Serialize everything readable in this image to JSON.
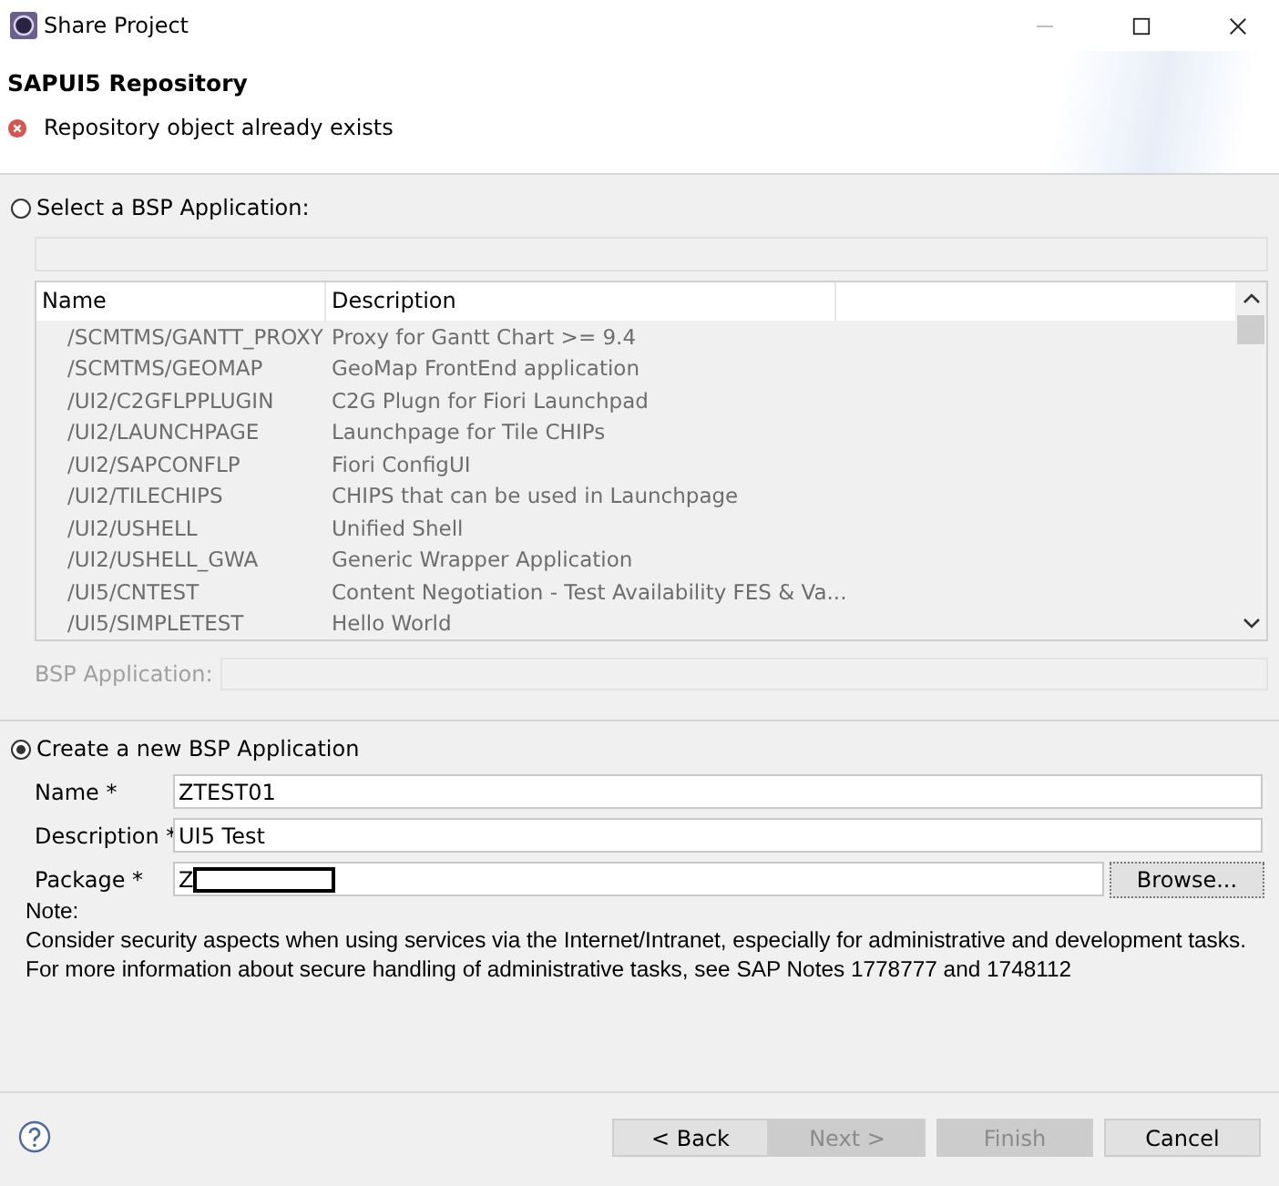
{
  "window": {
    "title": "Share Project"
  },
  "header": {
    "title": "SAPUI5 Repository",
    "message": {
      "kind": "error",
      "text": "Repository object already exists"
    }
  },
  "select_option": {
    "label": "Select a BSP Application:",
    "selected": false
  },
  "table": {
    "disabled": true,
    "columns": [
      "Name",
      "Description"
    ],
    "rows": [
      {
        "name": "/SCMTMS/GANTT_PROXY",
        "description": "Proxy for Gantt Chart >= 9.4"
      },
      {
        "name": "/SCMTMS/GEOMAP",
        "description": "GeoMap FrontEnd application"
      },
      {
        "name": "/UI2/C2GFLPPLUGIN",
        "description": "C2G Plugn for Fiori Launchpad"
      },
      {
        "name": "/UI2/LAUNCHPAGE",
        "description": "Launchpage for Tile CHIPs"
      },
      {
        "name": "/UI2/SAPCONFLP",
        "description": "Fiori ConfigUI"
      },
      {
        "name": "/UI2/TILECHIPS",
        "description": "CHIPS that can be used in Launchpage"
      },
      {
        "name": "/UI2/USHELL",
        "description": "Unified Shell"
      },
      {
        "name": "/UI2/USHELL_GWA",
        "description": "Generic Wrapper Application"
      },
      {
        "name": "/UI5/CNTEST",
        "description": "Content Negotiation - Test Availability FES & Va..."
      },
      {
        "name": "/UI5/SIMPLETEST",
        "description": "Hello World"
      }
    ]
  },
  "bsp_application": {
    "label": "BSP Application:",
    "disabled": true
  },
  "create_option": {
    "label": "Create a new BSP Application",
    "selected": true
  },
  "form": [
    {
      "label": "Name *",
      "value": "ZTEST01"
    },
    {
      "label": "Description *",
      "value": "UI5 Test"
    },
    {
      "label": "Package *",
      "value": "Z",
      "redacted": true,
      "button": "Browse..."
    }
  ],
  "note": {
    "title": "Note:",
    "lines": [
      "Consider security aspects when using services via the Internet/Intranet, especially for administrative and development tasks.",
      "For more information about secure handling of administrative tasks, see SAP Notes 1778777 and 1748112"
    ]
  },
  "buttons": [
    {
      "label": "< Back",
      "disabled": false
    },
    {
      "label": "Next >",
      "disabled": true
    },
    {
      "label": "Finish",
      "disabled": true
    },
    {
      "label": "Cancel",
      "disabled": false
    }
  ]
}
